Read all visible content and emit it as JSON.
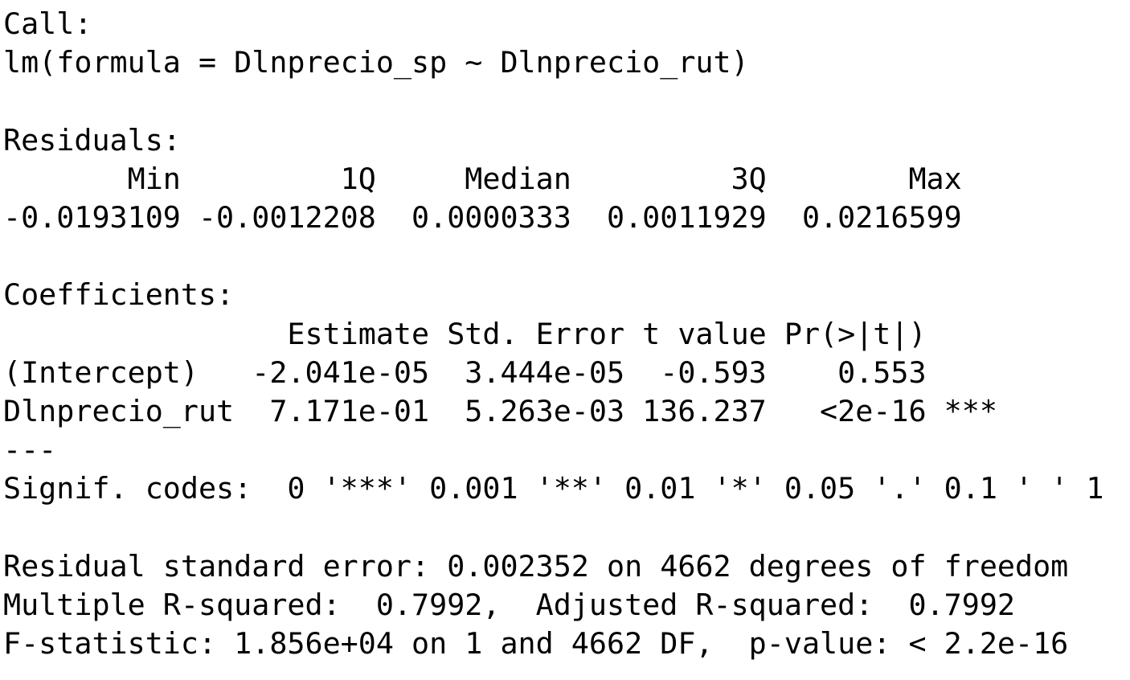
{
  "console": {
    "call_header": "Call:",
    "call_formula": "lm(formula = Dlnprecio_sp ~ Dlnprecio_rut)",
    "residuals_header": "Residuals:",
    "residuals_col_headers": "       Min         1Q     Median         3Q        Max ",
    "residuals_values": "-0.0193109 -0.0012208  0.0000333  0.0011929  0.0216599 ",
    "coefficients_header": "Coefficients:",
    "coef_col_headers": "                Estimate Std. Error t value Pr(>|t|)    ",
    "coef_row_intercept": "(Intercept)   -2.041e-05  3.444e-05  -0.593    0.553    ",
    "coef_row_dlnprecio_rut": "Dlnprecio_rut  7.171e-01  5.263e-03 136.237   <2e-16 ***",
    "separator": "---",
    "signif_codes": "Signif. codes:  0 '***' 0.001 '**' 0.01 '*' 0.05 '.' 0.1 ' ' 1",
    "residual_std_error": "Residual standard error: 0.002352 on 4662 degrees of freedom",
    "r_squared": "Multiple R-squared:  0.7992,  Adjusted R-squared:  0.7992 ",
    "f_statistic": "F-statistic: 1.856e+04 on 1 and 4662 DF,  p-value: < 2.2e-16"
  }
}
